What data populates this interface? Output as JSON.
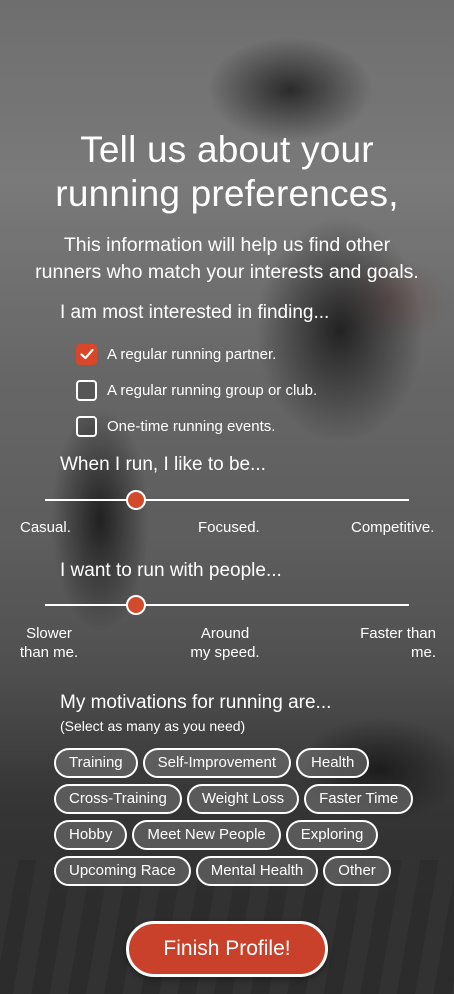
{
  "header": {
    "title_line1": "Tell us about your",
    "title_line2": "running preferences,",
    "subtitle_line1": "This information will help us find other",
    "subtitle_line2": "runners who match your interests and goals."
  },
  "interest": {
    "label": "I am most interested in finding...",
    "options": [
      {
        "label": "A regular running partner.",
        "checked": true
      },
      {
        "label": "A regular running group or club.",
        "checked": false
      },
      {
        "label": "One-time running events.",
        "checked": false
      }
    ]
  },
  "intensity": {
    "label": "When I run, I like to be...",
    "value_percent": 25,
    "ticks": [
      "Casual.",
      "Focused.",
      "Competitive."
    ]
  },
  "pace": {
    "label": "I want to run with people...",
    "value_percent": 25,
    "ticks": [
      {
        "line1": "Slower",
        "line2": "than me."
      },
      {
        "line1": "Around",
        "line2": "my speed."
      },
      {
        "line1": "Faster than",
        "line2": "me."
      }
    ]
  },
  "motivations": {
    "label": "My motivations for running are...",
    "hint": "(Select as many as you need)",
    "rows": [
      [
        "Training",
        "Self-Improvement",
        "Health"
      ],
      [
        "Cross-Training",
        "Weight Loss",
        "Faster Time"
      ],
      [
        "Hobby",
        "Meet New People",
        "Exploring"
      ],
      [
        "Upcoming Race",
        "Mental Health",
        "Other"
      ]
    ]
  },
  "finish_label": "Finish Profile!",
  "colors": {
    "accent": "#d24a2c",
    "button": "#c9412a"
  }
}
